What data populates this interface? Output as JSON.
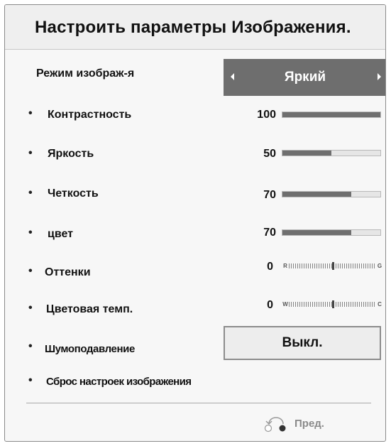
{
  "title": "Настроить параметры Изображения.",
  "picture_mode": {
    "label": "Режим изображ-я",
    "value": "Яркий"
  },
  "settings": [
    {
      "label": "Контрастность",
      "value": "100",
      "level": 100
    },
    {
      "label": "Яркость",
      "value": "50",
      "level": 50
    },
    {
      "label": "Четкость",
      "value": "70",
      "level": 70
    },
    {
      "label": "цвет",
      "value": "70",
      "level": 70
    }
  ],
  "tint": {
    "label": "Оттенки",
    "value": "0",
    "left": "R",
    "right": "G"
  },
  "color_temp": {
    "label": "Цветовая темп.",
    "value": "0",
    "left": "W",
    "right": "C"
  },
  "noise_reduction": {
    "label": "Шумоподавление",
    "value": "Выкл."
  },
  "reset": {
    "label": "Сброс настроек изображения"
  },
  "footer": {
    "back_label": "Пред."
  },
  "colors": {
    "bar_fill": "#6f6f6f",
    "selector_bg": "#6e6e6e"
  }
}
